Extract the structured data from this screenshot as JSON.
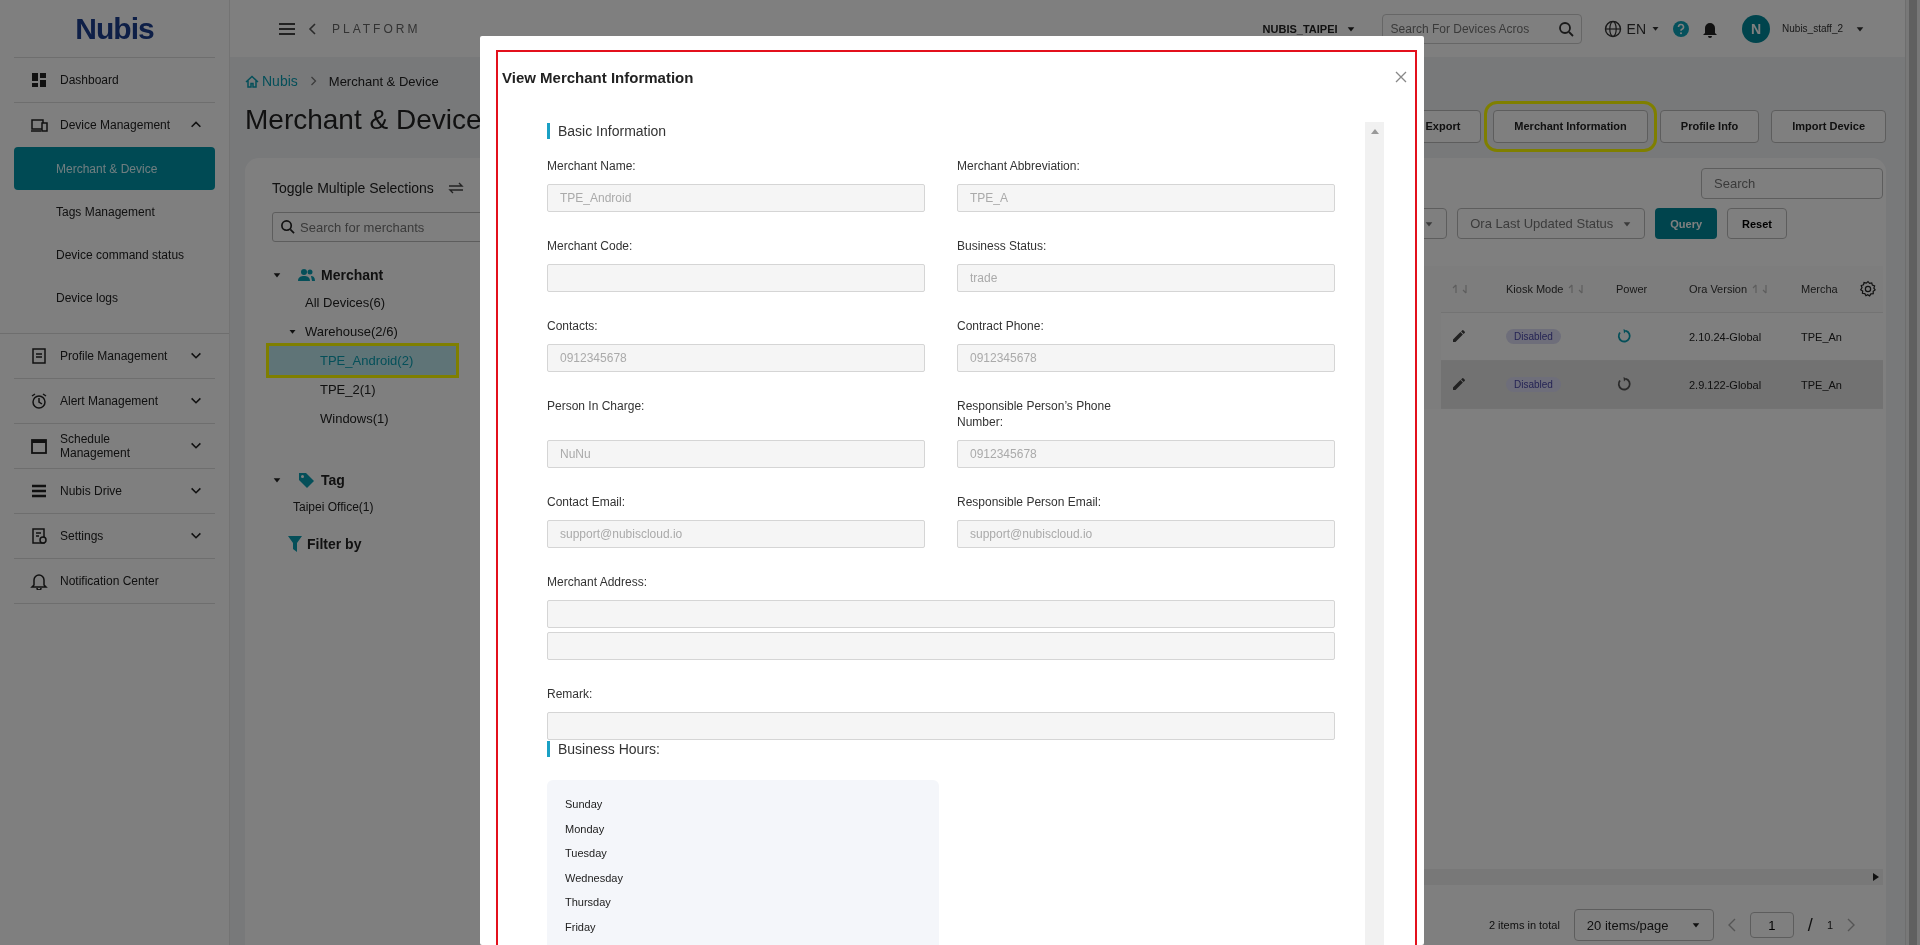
{
  "sidebar": {
    "logo": "Nubis",
    "items": [
      {
        "label": "Dashboard",
        "kind": "link"
      },
      {
        "label": "Device Management",
        "kind": "group",
        "expanded": true,
        "children": [
          {
            "label": "Merchant & Device",
            "selected": true
          },
          {
            "label": "Tags Management",
            "selected": false
          },
          {
            "label": "Device command status",
            "selected": false
          },
          {
            "label": "Device logs",
            "selected": false
          }
        ]
      },
      {
        "label": "Profile Management",
        "kind": "group",
        "expanded": false
      },
      {
        "label": "Alert Management",
        "kind": "group",
        "expanded": false
      },
      {
        "label": "Schedule Management",
        "kind": "group",
        "expanded": false
      },
      {
        "label": "Nubis Drive",
        "kind": "group",
        "expanded": false
      },
      {
        "label": "Settings",
        "kind": "group",
        "expanded": false
      },
      {
        "label": "Notification Center",
        "kind": "link"
      }
    ]
  },
  "topbar": {
    "back_label": "PLATFORM",
    "organization": "NUBIS_TAIPEI",
    "search": {
      "placeholder": "Search For Devices Acros"
    },
    "language": "EN",
    "avatar": "N",
    "user": "Nubis_staff_2"
  },
  "breadcrumb": [
    {
      "label": "Nubis"
    },
    {
      "label": "Merchant & Device"
    }
  ],
  "page_title": "Merchant & Device",
  "tree_panel": {
    "toggle_label": "Toggle Multiple Selections",
    "search": {
      "placeholder": "Search for merchants"
    },
    "groups": [
      {
        "label": "Merchant",
        "expanded": true,
        "items": [
          {
            "label": "All Devices(6)",
            "selected": false
          },
          {
            "label": "Warehouse(2/6)",
            "selected": false,
            "expanded": true,
            "children": [
              {
                "label": "TPE_Android(2)",
                "selected": true
              },
              {
                "label": "TPE_2(1)",
                "selected": false
              },
              {
                "label": "Windows(1)",
                "selected": false
              }
            ]
          }
        ]
      },
      {
        "label": "Tag",
        "expanded": true,
        "items": [
          {
            "label": "Taipei Office(1)",
            "selected": false
          }
        ]
      }
    ],
    "filter_label": "Filter by"
  },
  "actions": [
    "Export",
    "Merchant Information",
    "Profile Info",
    "Import Device"
  ],
  "filters": {
    "search": {
      "placeholder": "Search"
    },
    "select": {
      "placeholder": "Ora Last Updated Status"
    },
    "buttons": [
      "Query",
      "Reset"
    ]
  },
  "table": {
    "columns": [
      {
        "sortable": true
      },
      {
        "label": "Kiosk Mode",
        "sortable": true
      },
      {
        "label": "Power",
        "sortable": false
      },
      {
        "label": "Ora Version",
        "sortable": true
      },
      {
        "label": "Mercha",
        "sortable": false
      }
    ],
    "rows": [
      {
        "kiosk_mode": "Disabled",
        "power_highlighted": true,
        "ora_version": "2.10.24-Global",
        "merchant": "TPE_An",
        "hovered": false
      },
      {
        "kiosk_mode": "Disabled",
        "power_highlighted": false,
        "ora_version": "2.9.122-Global",
        "merchant": "TPE_An",
        "hovered": true
      }
    ]
  },
  "pagination": {
    "total": "2 items in total",
    "page_size": "20 items/page",
    "page": "1",
    "separator": "/",
    "pages": "1"
  },
  "modal": {
    "title": "View Merchant Information",
    "basic": {
      "title": "Basic Information",
      "fields": [
        {
          "label": "Merchant Name:",
          "value": "TPE_Android",
          "kind": "half"
        },
        {
          "label": "Merchant Abbreviation:",
          "value": "TPE_A",
          "kind": "half"
        },
        {
          "label": "Merchant Code:",
          "kind": "half"
        },
        {
          "label": "Business Status:",
          "value": "trade",
          "kind": "half"
        },
        {
          "label": "Contacts:",
          "value": "0912345678",
          "kind": "half"
        },
        {
          "label": "Contract Phone:",
          "value": "0912345678",
          "kind": "half"
        },
        {
          "label": "Person In Charge:",
          "value": "NuNu",
          "kind": "half"
        },
        {
          "label": "Responsible Person’s Phone Number:",
          "value": "0912345678",
          "kind": "half"
        },
        {
          "label": "Contact Email:",
          "value": "support@nubiscloud.io",
          "kind": "half"
        },
        {
          "label": "Responsible Person Email:",
          "value": "support@nubiscloud.io",
          "kind": "half"
        },
        {
          "label": "Merchant Address:",
          "kind": "address"
        },
        {
          "label": "Remark:",
          "kind": "wide"
        }
      ]
    },
    "hours": {
      "title": "Business Hours:",
      "days": [
        "Sunday",
        "Monday",
        "Tuesday",
        "Wednesday",
        "Thursday",
        "Friday"
      ]
    }
  }
}
